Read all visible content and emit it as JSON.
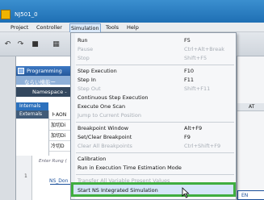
{
  "window": {
    "title": "NJ501_0"
  },
  "menubar": [
    "Project",
    "Controller",
    "Simulation",
    "Tools",
    "Help"
  ],
  "left_panel": {
    "programming_label": "Programming",
    "sub_label": "ならい機能ー",
    "namespace_label": "Namespace -",
    "tabs": [
      "Internals",
      "Externals"
    ],
    "grid_rows": [
      "トAON",
      "加切Di",
      "加切Di",
      "冷切D"
    ]
  },
  "ladder": {
    "rung_label": "Enter Rung (",
    "ns_done": "NS_Don",
    "rung_number": "1"
  },
  "right_panel": {
    "at_label": "AT",
    "en_label": "EN"
  },
  "simulation_menu": {
    "items": [
      {
        "label": "Run",
        "shortcut": "F5",
        "enabled": true
      },
      {
        "label": "Pause",
        "shortcut": "Ctrl+Alt+Break",
        "enabled": false
      },
      {
        "label": "Stop",
        "shortcut": "Shift+F5",
        "enabled": false
      },
      {
        "label": "Step Execution",
        "shortcut": "F10",
        "enabled": true
      },
      {
        "label": "Step In",
        "shortcut": "F11",
        "enabled": true
      },
      {
        "label": "Step Out",
        "shortcut": "Shift+F11",
        "enabled": false
      },
      {
        "label": "Continuous Step Execution",
        "shortcut": "",
        "enabled": true
      },
      {
        "label": "Execute One Scan",
        "shortcut": "",
        "enabled": true
      },
      {
        "label": "Jump to Current Position",
        "shortcut": "",
        "enabled": false
      },
      {
        "label": "Breakpoint Window",
        "shortcut": "Alt+F9",
        "enabled": true
      },
      {
        "label": "Set/Clear Breakpoint",
        "shortcut": "F9",
        "enabled": true
      },
      {
        "label": "Clear All Breakpoints",
        "shortcut": "Ctrl+Shift+F9",
        "enabled": false
      },
      {
        "label": "Calibration",
        "shortcut": "",
        "enabled": true
      },
      {
        "label": "Run in Execution Time Estimation Mode",
        "shortcut": "",
        "enabled": true
      },
      {
        "label": "Transfer All Variable Present Values",
        "shortcut": "",
        "enabled": false
      },
      {
        "label": "Start NS Integrated Simulation",
        "shortcut": "",
        "enabled": true
      }
    ]
  },
  "colors": {
    "highlight_border": "#3fae3f",
    "title_bar": "#1f6fb4",
    "disabled_text": "#a7adb5"
  },
  "icons": [
    "app-icon",
    "arrow-back-icon",
    "arrow-forward-icon",
    "save-icon",
    "build-icon",
    "mouse-cursor-icon"
  ]
}
